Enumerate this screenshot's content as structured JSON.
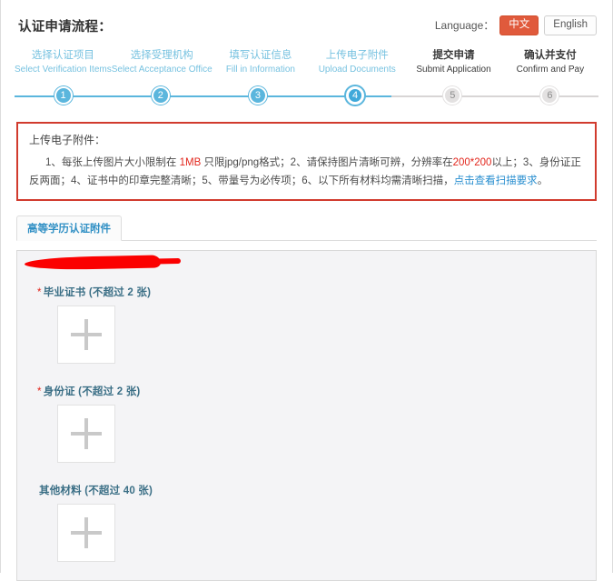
{
  "header": {
    "title": "认证申请流程：",
    "language_label": "Language：",
    "lang_active": "中文",
    "lang_inactive": "English"
  },
  "stepper": {
    "steps": [
      {
        "num": "1",
        "cn": "选择认证项目",
        "en": "Select Verification Items",
        "state": "done"
      },
      {
        "num": "2",
        "cn": "选择受理机构",
        "en": "Select Acceptance Office",
        "state": "done"
      },
      {
        "num": "3",
        "cn": "填写认证信息",
        "en": "Fill in Information",
        "state": "done"
      },
      {
        "num": "4",
        "cn": "上传电子附件",
        "en": "Upload Documents",
        "state": "active"
      },
      {
        "num": "5",
        "cn": "提交申请",
        "en": "Submit Application",
        "state": "todo"
      },
      {
        "num": "6",
        "cn": "确认并支付",
        "en": "Confirm and Pay",
        "state": "todo"
      }
    ],
    "colors": {
      "active": "#3fa9da",
      "done": "#5bb6dd",
      "todo": "#e3e1e1",
      "line_done": "#5bb6dd",
      "line_todo": "#d8d5d5"
    }
  },
  "notice": {
    "border_color": "#d13b2e",
    "title": "上传电子附件：",
    "seg1": "1、每张上传图片大小限制在 ",
    "seg2_red": "1MB",
    "seg3": " 只限jpg/png格式；2、请保持图片清晰可辨，分辨率在",
    "seg4_red": "200*200",
    "seg5": "以上；3、身份证正反两面；4、证书中的印章完整清晰；5、带量号为必传项；6、以下所有材料均需清晰扫描，",
    "seg6_link": "点击查看扫描要求",
    "seg7": "。"
  },
  "tabs": [
    {
      "label": "高等学历认证附件",
      "active": true
    }
  ],
  "upload": {
    "groups": [
      {
        "required": true,
        "star": "*",
        "label": "毕业证书 (不超过 2 张)",
        "max": 2,
        "plus_icon": "plus-icon"
      },
      {
        "required": true,
        "star": "*",
        "label": "身份证 (不超过 2 张)",
        "max": 2,
        "plus_icon": "plus-icon"
      },
      {
        "required": false,
        "star": "",
        "label": "其他材料 (不超过 40 张)",
        "max": 40,
        "plus_icon": "plus-icon"
      }
    ]
  }
}
